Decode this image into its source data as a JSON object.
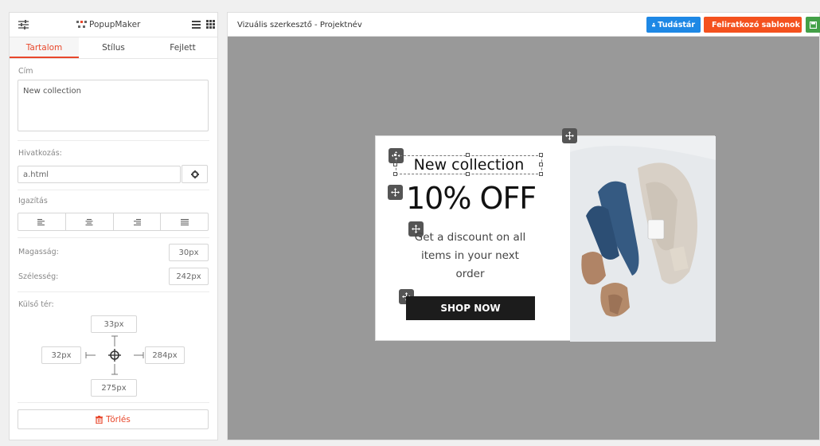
{
  "panel": {
    "brand": "PopupMaker",
    "tabs": [
      "Tartalom",
      "Stílus",
      "Fejlett"
    ],
    "fields": {
      "title_label": "Cím",
      "title_value": "New collection",
      "link_label": "Hivatkozás:",
      "link_value": "a.html",
      "align_label": "Igazítás",
      "height_label": "Magasság:",
      "height_value": "30px",
      "width_label": "Szélesség:",
      "width_value": "242px",
      "margin_label": "Külső tér:",
      "margin_top": "33px",
      "margin_left": "32px",
      "margin_right": "284px",
      "margin_bottom": "275px"
    },
    "delete_label": "Törlés"
  },
  "editor": {
    "title": "Vizuális szerkesztő - Projektnév",
    "buttons": {
      "knowledge": "Tudástár",
      "templates": "Feliratkozó sablonok"
    }
  },
  "popup": {
    "title": "New collection",
    "offer": "10% OFF",
    "description": "Get a discount on all items in your next order",
    "cta": "SHOP NOW"
  },
  "colors": {
    "accent": "#e8472b",
    "blue": "#1e88e5",
    "orange": "#f4511e",
    "green": "#43a047",
    "canvas": "#999999"
  },
  "icons": {
    "settings": "sliders-icon",
    "brand": "logo-icon",
    "menu": "menu-icon",
    "grid": "grid-icon",
    "link_settings": "gear-icon",
    "move": "move-icon",
    "delete": "trash-icon",
    "crosshair": "crosshair-icon"
  }
}
